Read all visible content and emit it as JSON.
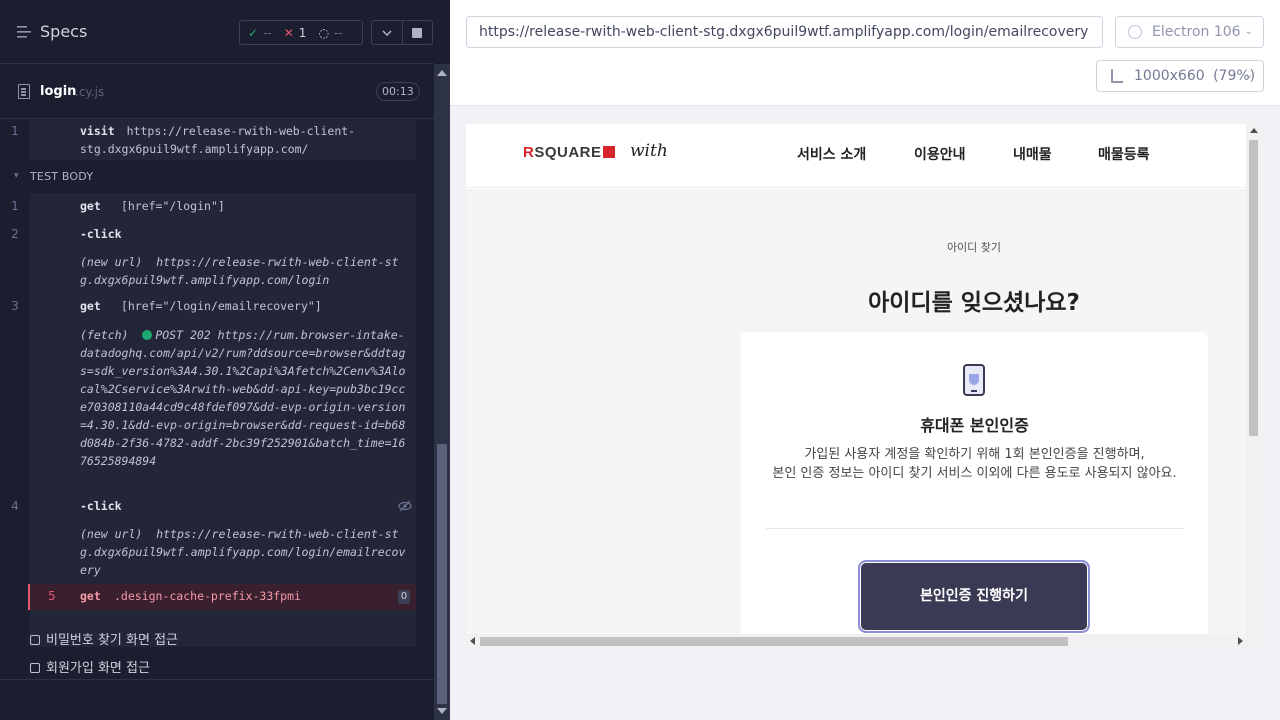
{
  "runner": {
    "title": "Specs",
    "stats": {
      "passed": "--",
      "failed": "1",
      "pending": "--"
    },
    "file": {
      "name": "login",
      "ext": ".cy.js",
      "duration": "00:13"
    },
    "section_label": "TEST BODY",
    "commands": [
      {
        "num": "1",
        "name": "visit",
        "message": "https://release-rwith-web-client-stg.dxgx6puil9wtf.amplifyapp.com/"
      },
      {
        "num": "1",
        "name": "get",
        "message": "[href=\"/login\"]"
      },
      {
        "num": "2",
        "name": "-click",
        "message": ""
      },
      {
        "num": "",
        "name": "(new url)",
        "message": "https://release-rwith-web-client-stg.dxgx6puil9wtf.amplifyapp.com/login"
      },
      {
        "num": "3",
        "name": "get",
        "message": "[href=\"/login/emailrecovery\"]"
      },
      {
        "num": "",
        "name": "(fetch)",
        "message": "POST 202 https://rum.browser-intake-datadoghq.com/api/v2/rum?ddsource=browser&ddtags=sdk_version%3A4.30.1%2Capi%3Afetch%2Cenv%3Alocal%2Cservice%3Arwith-web&dd-api-key=pub3bc19cce70308110a44cd9c48fdef097&dd-evp-origin-version=4.30.1&dd-evp-origin=browser&dd-request-id=b68d084b-2f36-4782-addf-2bc39f252901&batch_time=1676525894894"
      },
      {
        "num": "4",
        "name": "-click",
        "message": ""
      },
      {
        "num": "",
        "name": "(new url)",
        "message": "https://release-rwith-web-client-stg.dxgx6puil9wtf.amplifyapp.com/login/emailrecovery"
      },
      {
        "num": "5",
        "name": "get",
        "message": ".design-cache-prefix-33fpmi",
        "badge": "0"
      }
    ],
    "tests": [
      "비밀번호 찾기 화면 접근",
      "회원가입 화면 접근"
    ]
  },
  "browser_bar": {
    "url": "https://release-rwith-web-client-stg.dxgx6puil9wtf.amplifyapp.com/login/emailrecovery",
    "browser": "Electron 106",
    "viewport": "1000x660",
    "zoom": "(79%)"
  },
  "site": {
    "logo_r": "R",
    "logo_rest": "SQUARE",
    "logo_with": "with",
    "nav": [
      "서비스 소개",
      "이용안내",
      "내매물",
      "매물등록"
    ],
    "eyebrow": "아이디 찾기",
    "headline": "아이디를 잊으셨나요?",
    "card_title": "휴대폰 본인인증",
    "card_desc_1": "가입된 사용자 계정을 확인하기 위해 1회 본인인증을 진행하며,",
    "card_desc_2": "본인 인증 정보는 아이디 찾기 서비스 이외에 다른 용도로 사용되지 않아요.",
    "button": "본인인증 진행하기"
  }
}
